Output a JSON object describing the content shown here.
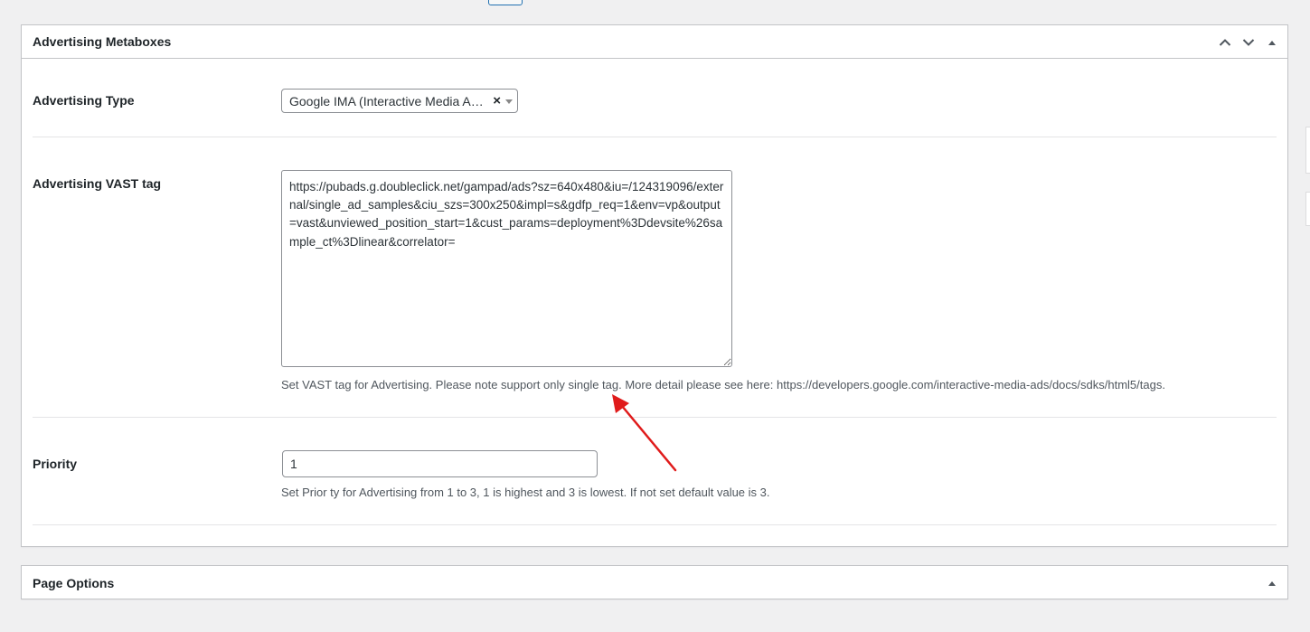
{
  "metabox": {
    "title": "Advertising Metaboxes",
    "controls": {
      "move_up_icon": "chevron-up-icon",
      "move_down_icon": "chevron-down-icon",
      "toggle_icon": "triangle-up-icon"
    },
    "fields": {
      "advertising_type": {
        "label": "Advertising Type",
        "selected": "Google IMA (Interactive Media A…",
        "clear_glyph": "×"
      },
      "vast_tag": {
        "label": "Advertising VAST tag",
        "value": "https://pubads.g.doubleclick.net/gampad/ads?sz=640x480&iu=/124319096/external/single_ad_samples&ciu_szs=300x250&impl=s&gdfp_req=1&env=vp&output=vast&unviewed_position_start=1&cust_params=deployment%3Ddevsite%26sample_ct%3Dlinear&correlator=",
        "description": "Set VAST tag for Advertising. Please note support only single tag. More detail please see here: https://developers.google.com/interactive-media-ads/docs/sdks/html5/tags."
      },
      "priority": {
        "label": "Priority",
        "value": "1",
        "description": "Set Prior ty for Advertising from 1 to 3, 1 is highest and 3 is lowest. If not set default value is 3."
      }
    }
  },
  "page_options": {
    "title": "Page Options",
    "toggle_icon": "triangle-up-icon"
  },
  "annotation": {
    "arrow_color": "#e01b1b"
  },
  "colors": {
    "background": "#f0f0f1",
    "border": "#c3c4c7",
    "text": "#1d2327",
    "muted_text": "#50575e"
  }
}
